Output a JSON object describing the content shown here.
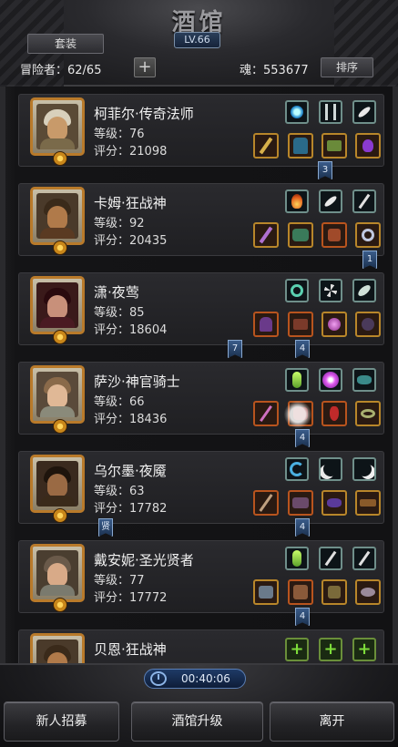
{
  "header": {
    "title": "酒馆",
    "level": "LV.66",
    "set_label": "套装",
    "adventurer_text": "冒险者：62/65",
    "soul_text": "魂：553677",
    "sort_label": "排序"
  },
  "heroes": [
    {
      "name": "柯菲尔·传奇法师",
      "level": "等级：76",
      "score": "评分：21098"
    },
    {
      "name": "卡姆·狂战神",
      "level": "等级：92",
      "score": "评分：20435"
    },
    {
      "name": "潇·夜莺",
      "level": "等级：85",
      "score": "评分：18604"
    },
    {
      "name": "萨沙·神官骑士",
      "level": "等级：66",
      "score": "评分：18436"
    },
    {
      "name": "乌尔墨·夜魇",
      "level": "等级：63",
      "score": "评分：17782"
    },
    {
      "name": "戴安妮·圣光贤者",
      "level": "等级：77",
      "score": "评分：17772"
    },
    {
      "name": "贝恩·狂战神"
    }
  ],
  "flags": {
    "f1": "3",
    "f2": "1",
    "f3a": "7",
    "f3b": "4",
    "f4": "4",
    "f5a": "贤",
    "f5b": "4",
    "f6": "4"
  },
  "add_glyph": "+",
  "timer": "00:40:06",
  "footer": {
    "recruit_label": "新人招募",
    "upgrade_label": "酒馆升级",
    "leave_label": "离开"
  }
}
